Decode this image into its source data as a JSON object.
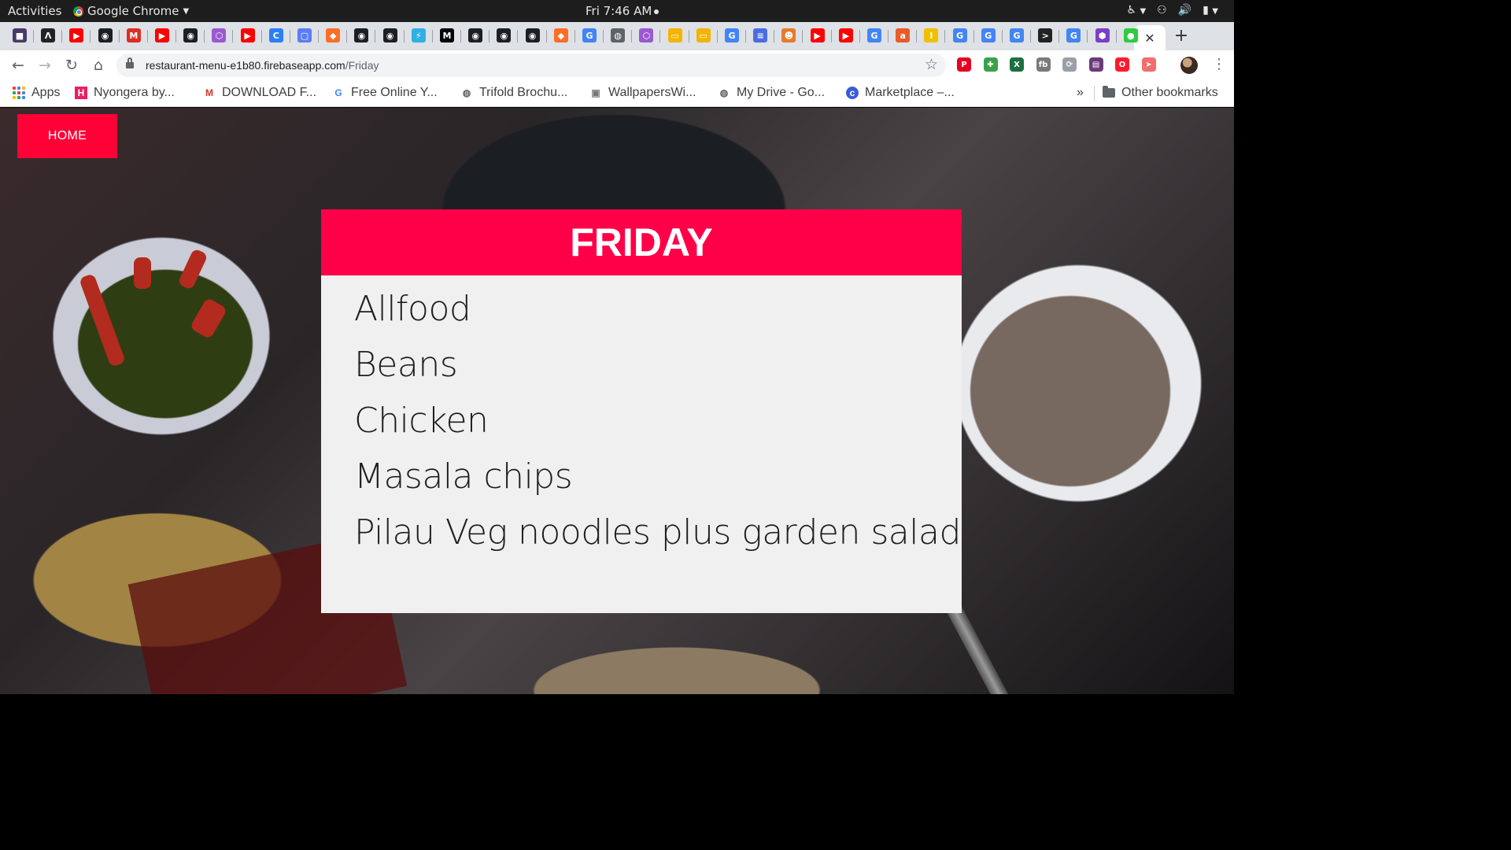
{
  "system_bar": {
    "activities": "Activities",
    "app_name": "Google Chrome",
    "clock": "Fri  7:46 AM"
  },
  "browser": {
    "tabs": [
      {
        "icon": "profile-icon",
        "color": "#4a3a6a"
      },
      {
        "icon": "arch-icon",
        "color": "#222222"
      },
      {
        "icon": "youtube-icon",
        "color": "#ff0000"
      },
      {
        "icon": "github-icon",
        "color": "#1b1f23"
      },
      {
        "icon": "gmail-icon",
        "color": "#d93025"
      },
      {
        "icon": "youtube-icon",
        "color": "#ff0000"
      },
      {
        "icon": "github-icon",
        "color": "#1b1f23"
      },
      {
        "icon": "graphql-icon",
        "color": "#9b59d0"
      },
      {
        "icon": "youtube-icon",
        "color": "#ff0000"
      },
      {
        "icon": "blue-c-icon",
        "color": "#2d7ff9"
      },
      {
        "icon": "meet-icon",
        "color": "#5b7cf5"
      },
      {
        "icon": "gitlab-icon",
        "color": "#fc6d26"
      },
      {
        "icon": "github-icon",
        "color": "#1b1f23"
      },
      {
        "icon": "github-icon",
        "color": "#1b1f23"
      },
      {
        "icon": "stackblitz-icon",
        "color": "#2fb0e5"
      },
      {
        "icon": "medium-icon",
        "color": "#000000"
      },
      {
        "icon": "github-icon",
        "color": "#1b1f23"
      },
      {
        "icon": "github-icon",
        "color": "#1b1f23"
      },
      {
        "icon": "github-icon",
        "color": "#1b1f23"
      },
      {
        "icon": "gitlab-icon",
        "color": "#fc6d26"
      },
      {
        "icon": "google-icon",
        "color": "#4285f4"
      },
      {
        "icon": "globe-icon",
        "color": "#5f6368"
      },
      {
        "icon": "graphql-icon",
        "color": "#9b59d0"
      },
      {
        "icon": "slides-icon",
        "color": "#f4b400"
      },
      {
        "icon": "slides-icon",
        "color": "#f4b400"
      },
      {
        "icon": "google-icon",
        "color": "#4285f4"
      },
      {
        "icon": "docs-icon",
        "color": "#4a6ee0"
      },
      {
        "icon": "fox-icon",
        "color": "#e97a2b"
      },
      {
        "icon": "youtube-icon",
        "color": "#ff0000"
      },
      {
        "icon": "youtube-icon",
        "color": "#ff0000"
      },
      {
        "icon": "google-icon",
        "color": "#4285f4"
      },
      {
        "icon": "ask-icon",
        "color": "#e95b2b"
      },
      {
        "icon": "lastpass-l-icon",
        "color": "#f0c000"
      },
      {
        "icon": "google-icon",
        "color": "#4285f4"
      },
      {
        "icon": "google-icon",
        "color": "#4285f4"
      },
      {
        "icon": "google-icon",
        "color": "#4285f4"
      },
      {
        "icon": "terminal-icon",
        "color": "#222222"
      },
      {
        "icon": "google-icon",
        "color": "#4285f4"
      },
      {
        "icon": "hexagon-icon",
        "color": "#7b3fc6"
      },
      {
        "icon": "green-circle-icon",
        "color": "#2ecc40"
      }
    ],
    "url_host": "restaurant-menu-e1b80.firebaseapp.com",
    "url_path": "/Friday",
    "extensions": [
      {
        "icon": "pinterest-icon",
        "color": "#e60023"
      },
      {
        "icon": "extension-green-icon",
        "color": "#3aa14a"
      },
      {
        "icon": "excel-icon",
        "color": "#1d6f42"
      },
      {
        "icon": "fb-icon",
        "color": "#7a7a7a"
      },
      {
        "icon": "sync-icon",
        "color": "#9aa0a6"
      },
      {
        "icon": "bookmark-ext-icon",
        "color": "#6b3a7a"
      },
      {
        "icon": "opera-icon",
        "color": "#ff1b2d"
      },
      {
        "icon": "arrow-ext-icon",
        "color": "#f26d6d"
      }
    ]
  },
  "bookmarks": [
    {
      "label": "Apps",
      "icon": "apps-grid-icon"
    },
    {
      "label": "Nyongera by...",
      "icon": "h-icon",
      "color": "#e91e63"
    },
    {
      "label": "DOWNLOAD F...",
      "icon": "gmail-icon",
      "color": "#d93025"
    },
    {
      "label": "Free Online Y...",
      "icon": "google-icon",
      "color": "#4285f4"
    },
    {
      "label": "Trifold Brochu...",
      "icon": "globe-icon",
      "color": "#5f6368"
    },
    {
      "label": "WallpapersWi...",
      "icon": "wallpaper-icon",
      "color": "#777777"
    },
    {
      "label": "My Drive - Go...",
      "icon": "globe-icon",
      "color": "#5f6368"
    },
    {
      "label": "Marketplace –...",
      "icon": "marketplace-icon",
      "color": "#3b5bdb"
    }
  ],
  "bookmarks_overflow": "»",
  "other_bookmarks": "Other bookmarks",
  "page": {
    "home_label": "HOME",
    "day_title": "FRIDAY",
    "menu_items": [
      "Allfood",
      "Beans",
      "Chicken",
      "Masala chips",
      "Pilau Veg noodles plus garden salad"
    ]
  },
  "colors": {
    "accent": "#ff0048",
    "home_button": "#ff0037",
    "card_background": "#f0f0f0"
  }
}
